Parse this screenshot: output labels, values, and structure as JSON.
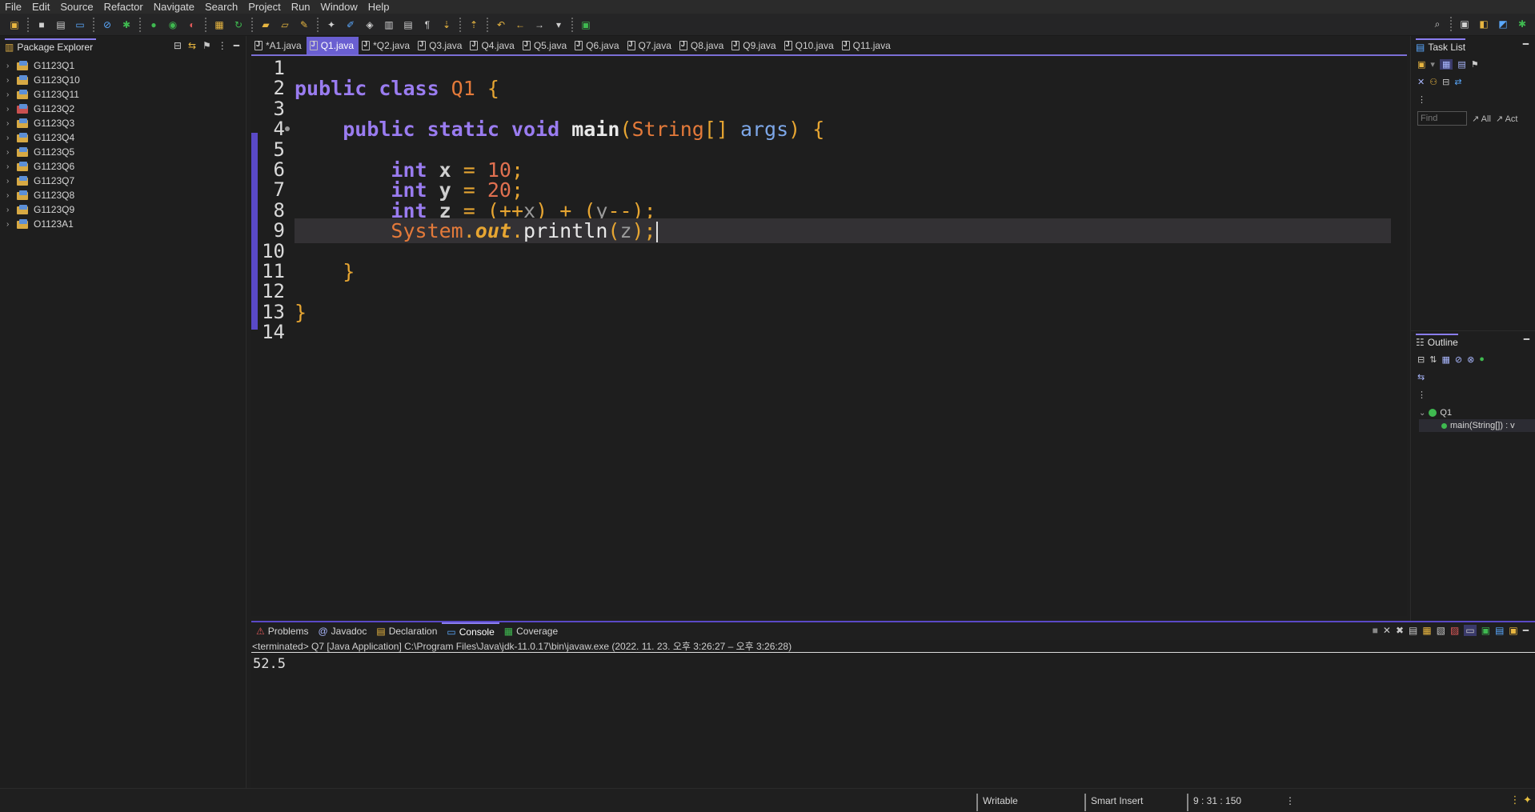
{
  "menu": [
    "File",
    "Edit",
    "Source",
    "Refactor",
    "Navigate",
    "Search",
    "Project",
    "Run",
    "Window",
    "Help"
  ],
  "left_panel": {
    "title": "Package Explorer",
    "projects": [
      {
        "name": "G1123Q1",
        "error": false
      },
      {
        "name": "G1123Q10",
        "error": false
      },
      {
        "name": "G1123Q11",
        "error": false
      },
      {
        "name": "G1123Q2",
        "error": true
      },
      {
        "name": "G1123Q3",
        "error": false
      },
      {
        "name": "G1123Q4",
        "error": false
      },
      {
        "name": "G1123Q5",
        "error": false
      },
      {
        "name": "G1123Q6",
        "error": false
      },
      {
        "name": "G1123Q7",
        "error": false
      },
      {
        "name": "G1123Q8",
        "error": false
      },
      {
        "name": "G1123Q9",
        "error": false
      },
      {
        "name": "O1123A1",
        "error": false
      }
    ]
  },
  "editor_tabs": [
    {
      "label": "*A1.java",
      "active": false
    },
    {
      "label": "Q1.java",
      "active": true
    },
    {
      "label": "*Q2.java",
      "active": false
    },
    {
      "label": "Q3.java",
      "active": false
    },
    {
      "label": "Q4.java",
      "active": false
    },
    {
      "label": "Q5.java",
      "active": false
    },
    {
      "label": "Q6.java",
      "active": false
    },
    {
      "label": "Q7.java",
      "active": false
    },
    {
      "label": "Q8.java",
      "active": false
    },
    {
      "label": "Q9.java",
      "active": false
    },
    {
      "label": "Q10.java",
      "active": false
    },
    {
      "label": "Q11.java",
      "active": false
    }
  ],
  "code_lines": [
    {
      "num": "1",
      "tokens": []
    },
    {
      "num": "2",
      "tokens": [
        [
          "kw",
          "public class "
        ],
        [
          "cls",
          "Q1"
        ],
        [
          "punc",
          " {"
        ]
      ]
    },
    {
      "num": "3",
      "tokens": []
    },
    {
      "num": "4",
      "annotated": true,
      "tokens": [
        [
          "plain",
          "    "
        ],
        [
          "kw",
          "public static void "
        ],
        [
          "meth",
          "main"
        ],
        [
          "punc",
          "("
        ],
        [
          "cls",
          "String"
        ],
        [
          "punc",
          "[] "
        ],
        [
          "par",
          "args"
        ],
        [
          "punc",
          ") {"
        ]
      ]
    },
    {
      "num": "5",
      "tokens": []
    },
    {
      "num": "6",
      "tokens": [
        [
          "plain",
          "        "
        ],
        [
          "kw",
          "int "
        ],
        [
          "var",
          "x"
        ],
        [
          "op",
          " = "
        ],
        [
          "num",
          "10"
        ],
        [
          "punc",
          ";"
        ]
      ]
    },
    {
      "num": "7",
      "tokens": [
        [
          "plain",
          "        "
        ],
        [
          "kw",
          "int "
        ],
        [
          "var",
          "y"
        ],
        [
          "op",
          " = "
        ],
        [
          "num",
          "20"
        ],
        [
          "punc",
          ";"
        ]
      ]
    },
    {
      "num": "8",
      "tokens": [
        [
          "plain",
          "        "
        ],
        [
          "kw",
          "int "
        ],
        [
          "var",
          "z"
        ],
        [
          "op",
          " = "
        ],
        [
          "punc",
          "("
        ],
        [
          "op",
          "++"
        ],
        [
          "dim",
          "x"
        ],
        [
          "punc",
          ")"
        ],
        [
          "op",
          " + "
        ],
        [
          "punc",
          "("
        ],
        [
          "dim",
          "y"
        ],
        [
          "op",
          "--"
        ],
        [
          "punc",
          ");"
        ]
      ]
    },
    {
      "num": "9",
      "highlight": true,
      "caret": true,
      "tokens": [
        [
          "plain",
          "        "
        ],
        [
          "cls",
          "System"
        ],
        [
          "punc",
          "."
        ],
        [
          "fld",
          "out"
        ],
        [
          "punc",
          "."
        ],
        [
          "meth2",
          "println"
        ],
        [
          "punc",
          "("
        ],
        [
          "dim",
          "z"
        ],
        [
          "punc",
          ");"
        ]
      ]
    },
    {
      "num": "10",
      "tokens": []
    },
    {
      "num": "11",
      "tokens": [
        [
          "plain",
          "    "
        ],
        [
          "punc",
          "}"
        ]
      ]
    },
    {
      "num": "12",
      "tokens": []
    },
    {
      "num": "13",
      "tokens": [
        [
          "punc",
          "}"
        ]
      ]
    },
    {
      "num": "14",
      "tokens": []
    }
  ],
  "right_panel": {
    "task_list_title": "Task List",
    "find_placeholder": "Find",
    "filter_all": "All",
    "filter_act": "Act",
    "outline_title": "Outline",
    "outline_class": "Q1",
    "outline_method": "main(String[]) : v"
  },
  "console": {
    "tabs": [
      {
        "label": "Problems",
        "active": false
      },
      {
        "label": "Javadoc",
        "active": false
      },
      {
        "label": "Declaration",
        "active": false
      },
      {
        "label": "Console",
        "active": true
      },
      {
        "label": "Coverage",
        "active": false
      }
    ],
    "status": "<terminated> Q7 [Java Application] C:\\Program Files\\Java\\jdk-11.0.17\\bin\\javaw.exe  (2022. 11. 23. 오후 3:26:27 – 오후 3:26:28)",
    "output": "52.5"
  },
  "statusbar": {
    "writable": "Writable",
    "insert_mode": "Smart Insert",
    "position": "9 : 31 : 150"
  }
}
